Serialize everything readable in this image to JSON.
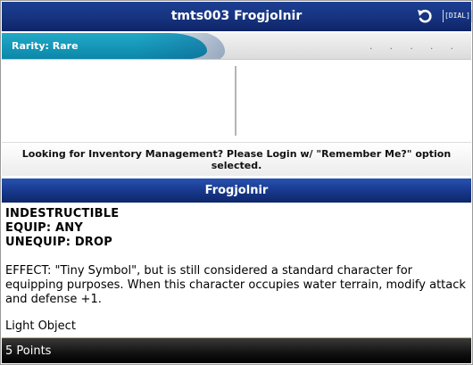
{
  "header": {
    "title": "tmts003 Frogjolnir",
    "back_icon": "back-arrow-icon",
    "dial_label": "[DIAL]"
  },
  "rarity": {
    "label": "Rarity: Rare",
    "dots": ". . . . ."
  },
  "notice": {
    "text": "Looking for Inventory Management? Please Login w/ \"Remember Me?\" option selected."
  },
  "card": {
    "name": "Frogjolnir",
    "keywords": [
      "INDESTRUCTIBLE",
      "EQUIP: ANY",
      "UNEQUIP: DROP"
    ],
    "effect": "EFFECT: \"Tiny Symbol\", but is still considered a standard character for equipping purposes. When this character occupies water terrain, modify attack and defense +1.",
    "type": "Light Object"
  },
  "footer": {
    "points": "5 Points"
  },
  "colors": {
    "title_bar": "#16337f",
    "rarity_accent": "#0a86a9",
    "footer_bg": "#111111",
    "footer_rule": "#c8b06a"
  }
}
